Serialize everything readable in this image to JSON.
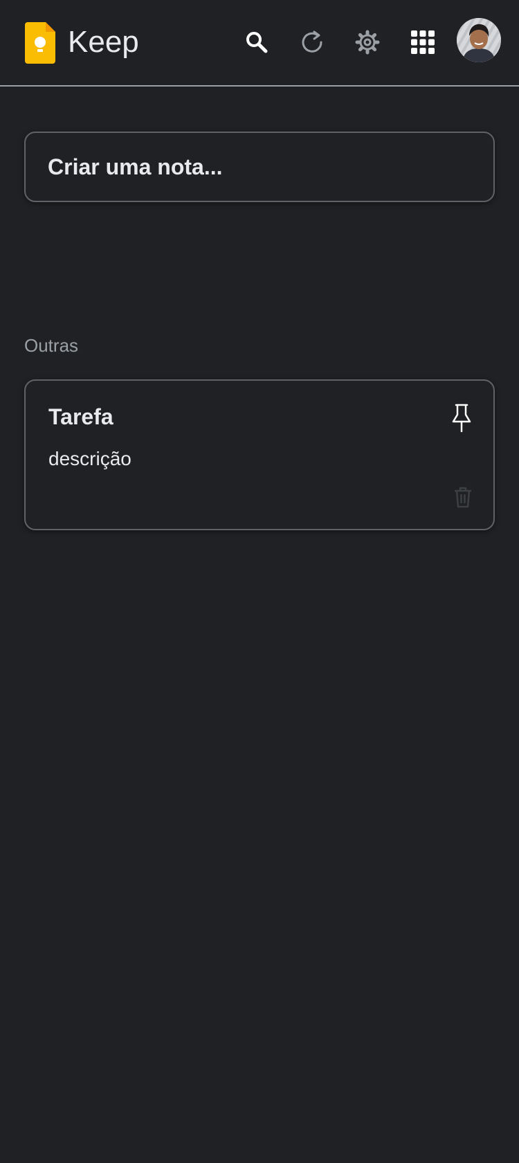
{
  "header": {
    "brand": "Keep",
    "logo_icon": "keep-bulb-logo",
    "actions": [
      {
        "name": "search",
        "icon": "search-icon"
      },
      {
        "name": "refresh",
        "icon": "refresh-icon"
      },
      {
        "name": "settings",
        "icon": "gear-icon"
      },
      {
        "name": "apps",
        "icon": "grid-apps-icon"
      }
    ],
    "avatar_icon": "user-avatar"
  },
  "create_note": {
    "label": "Criar uma nota..."
  },
  "sections": {
    "others_label": "Outras"
  },
  "notes": [
    {
      "title": "Tarefa",
      "description": "descrição",
      "pin_icon": "pin-icon",
      "delete_icon": "trash-icon"
    }
  ],
  "colors": {
    "background": "#202124",
    "text": "#e8eaed",
    "muted_text": "#9aa0a6",
    "border": "#5f6368",
    "logo_yellow": "#fbbc04",
    "logo_fold": "#f29900"
  }
}
